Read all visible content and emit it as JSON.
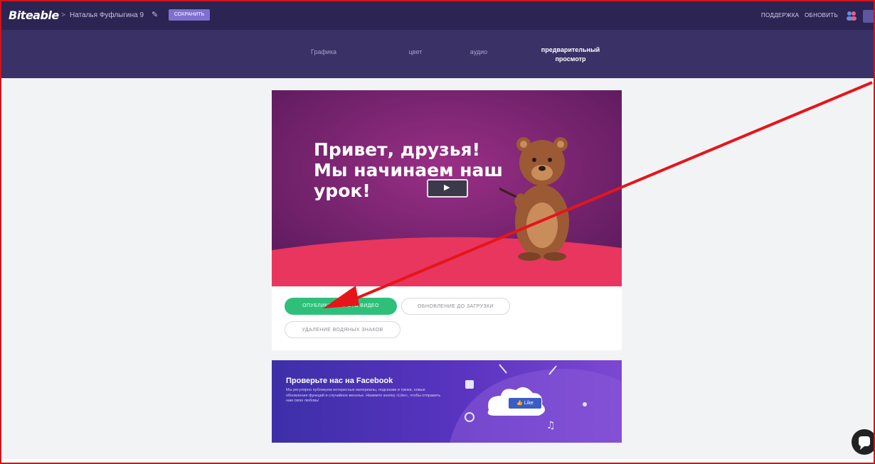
{
  "header": {
    "logo": "Biteable",
    "breadcrumb_separator": ">",
    "project_name": "Наталья Фуфлыгина 9",
    "edit_icon": "pencil-icon",
    "save_label": "СОХРАНИТЬ",
    "support_label": "ПОДДЕРЖКА",
    "upgrade_label": "ОБНОВИТЬ",
    "users_icon": "users-icon"
  },
  "tabs": {
    "graphics": "Графика",
    "color": "цвет",
    "audio": "аудио",
    "preview": "предварительный\nпросмотр"
  },
  "video": {
    "headline": "Привет, друзья!\nМы начинаем наш\nурок!",
    "play_icon": "play-icon"
  },
  "actions": {
    "publish": "ОПУБЛИКОВАТЬ ЭТО ВИДЕО",
    "upgrade_download": "ОБНОВЛЕНИЕ ДО ЗАГРУЗКИ",
    "remove_watermark": "УДАЛЕНИЕ ВОДЯНЫХ ЗНАКОВ"
  },
  "facebook_banner": {
    "title": "Проверьте нас на Facebook",
    "description": "Мы регулярно публикуем интересные материалы, подсказки и трюки, новые обновления функций и случайное веселье. Нажмите кнопку «Like», чтобы отправить нам свою любовь!",
    "like_label": "Like"
  },
  "colors": {
    "topbar": "#2c2452",
    "tabbar": "#3a3166",
    "accent_green": "#2ec07a",
    "annotation_red": "#e5151a"
  }
}
